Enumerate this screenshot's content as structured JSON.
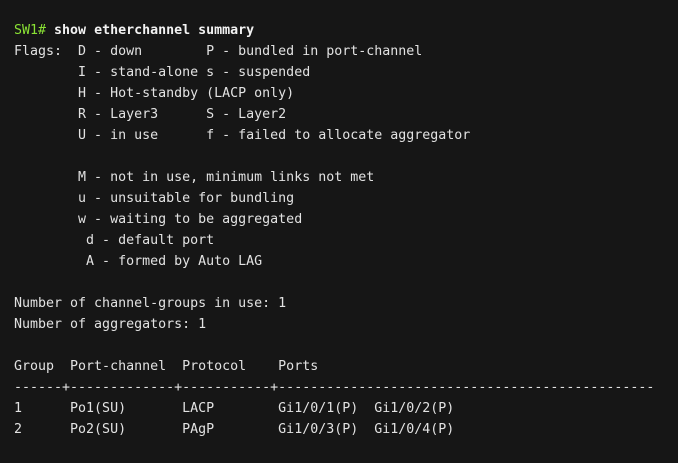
{
  "colors": {
    "background": "#161616",
    "text": "#e2e2e2",
    "prompt": "#8ae234"
  },
  "prompt": "SW1#",
  "command": " show etherchannel summary",
  "flags": [
    "Flags:  D - down        P - bundled in port-channel",
    "        I - stand-alone s - suspended",
    "        H - Hot-standby (LACP only)",
    "        R - Layer3      S - Layer2",
    "        U - in use      f - failed to allocate aggregator",
    "",
    "        M - not in use, minimum links not met",
    "        u - unsuitable for bundling",
    "        w - waiting to be aggregated",
    "         d - default port",
    "         A - formed by Auto LAG",
    ""
  ],
  "summary": [
    "Number of channel-groups in use: 1",
    "Number of aggregators: 1",
    ""
  ],
  "table": {
    "header": "Group  Port-channel  Protocol    Ports",
    "separator": "------+-------------+-----------+-----------------------------------------------",
    "rows": [
      "1      Po1(SU)       LACP        Gi1/0/1(P)  Gi1/0/2(P)",
      "2      Po2(SU)       PAgP        Gi1/0/3(P)  Gi1/0/4(P)"
    ]
  }
}
